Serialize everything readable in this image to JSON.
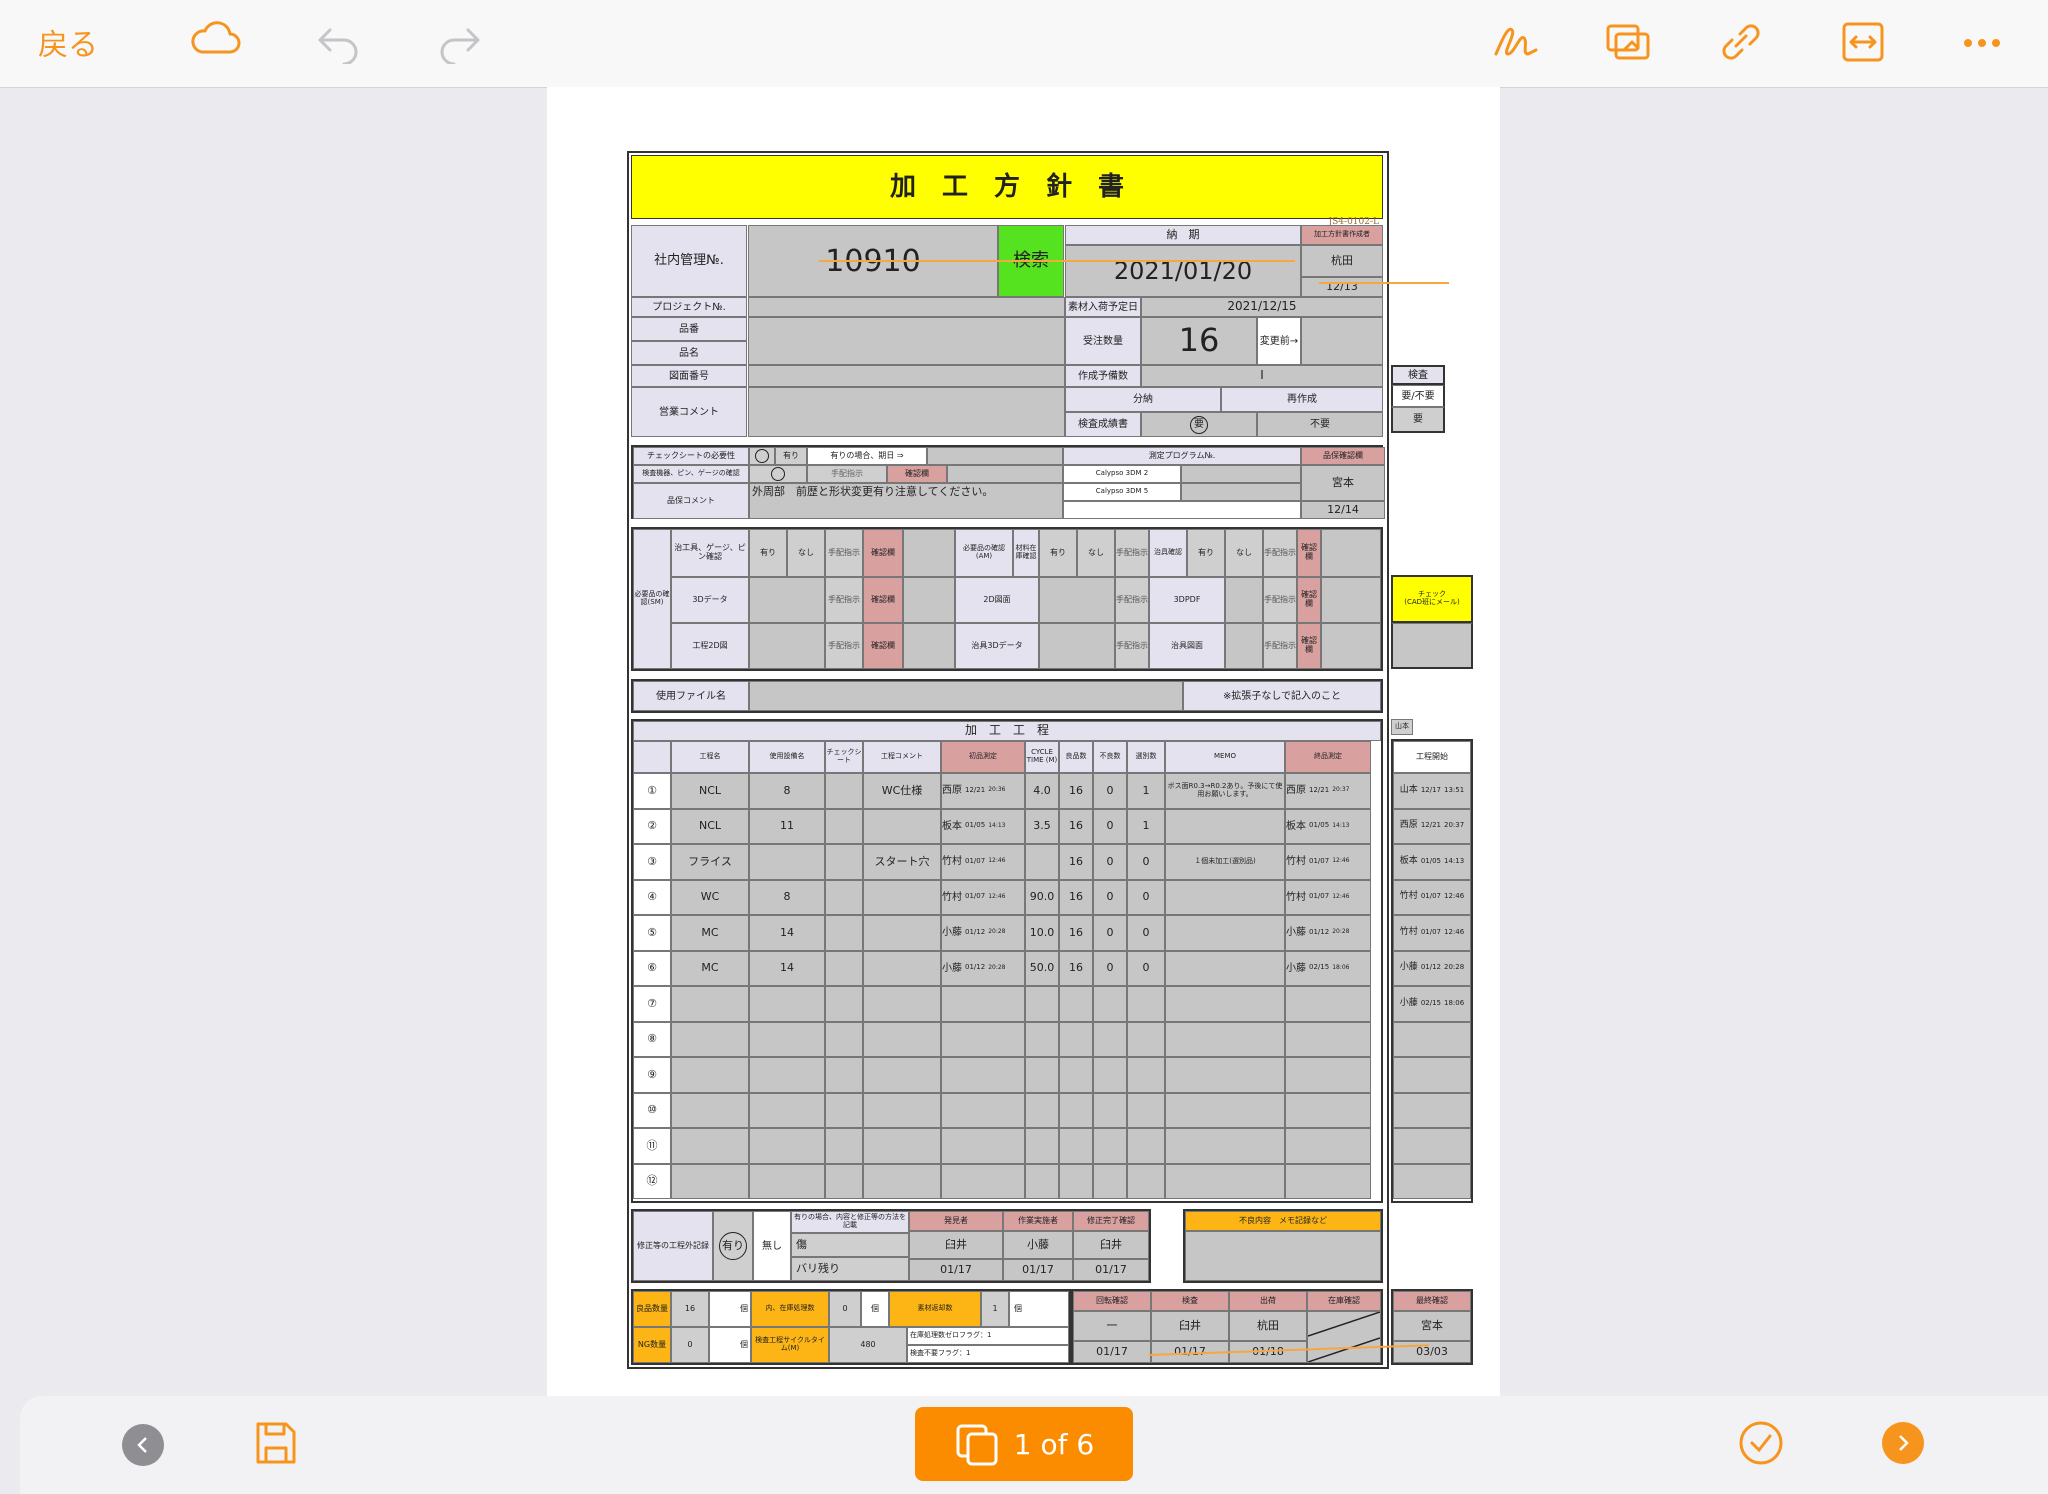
{
  "toolbar": {
    "back_label": "戻る",
    "icons": [
      "cloud-icon",
      "undo-icon",
      "redo-icon",
      "pen-icon",
      "annotate-icon",
      "link-icon",
      "fit-width-icon",
      "more-icon"
    ]
  },
  "doc": {
    "title": "加　工　方　針　書",
    "form_code": "JS4-0102-L",
    "mgmt_label": "社内管理№.",
    "mgmt_no": "10910",
    "search_btn": "検索",
    "nouki_label": "納　期",
    "nouki": "2021/01/20",
    "author_label": "加工方針書作成者",
    "author": "杭田",
    "author_date": "12/13",
    "project_label": "プロジェクト№.",
    "material_label": "素材入荷予定日",
    "material_date": "2021/12/15",
    "hinban_label": "品番",
    "hinmei_label": "品名",
    "zumen_label": "図面番号",
    "order_qty_label": "受注数量",
    "order_qty": "16",
    "change_label": "変更前→",
    "spare_label": "作成予備数",
    "spare_val": "I",
    "sales_label": "営業コメント",
    "bunno": "分納",
    "saisakusei": "再作成",
    "inspect_doc": "検査成績書",
    "yo": "要",
    "fuyo": "不要",
    "kensa": "検査",
    "yofuyo": "要/不要",
    "yo2": "要",
    "check_sheet_label": "チェックシートの必要性",
    "ari": "有り",
    "ari_note": "有りの場合、期日 ⇒",
    "gauge_label": "検査機器、ピン、ゲージの確認",
    "tehai": "手配指示",
    "kakunin": "確認欄",
    "qa_comment_label": "品保コメント",
    "qa_comment": "外周部　前歴と形状変更有り注意してください。",
    "program_label": "測定プログラム№.",
    "program1": "Calypso 3DM 2",
    "program2": "Calypso 3DM 5",
    "qa_check_label": "品保確認欄",
    "qa_name": "宮本",
    "qa_date": "12/14",
    "req_label": "必要品の確認(SM)",
    "jig_label": "治工具、ゲージ、ピン確認",
    "nashi": "なし",
    "data3d": "3Dデータ",
    "drawing2d": "工程2D図",
    "am_label": "必要品の確認(AM)",
    "zaiko": "材料在庫確認",
    "zumen2d": "2D図面",
    "jig3d": "治具3Dデータ",
    "jig_label2": "治具確認",
    "pdf3d": "3DPDF",
    "jig_drawing": "治具図面",
    "check_cad": "チェック\n(CAD班にメール)",
    "file_label": "使用ファイル名",
    "file_note": "※拡張子なしで記入のこと",
    "process_title": "加　工　工　程",
    "yamamoto_tag": "山本",
    "proc_headers": [
      "工程名",
      "使用設備名",
      "チェックシート",
      "工程コメント",
      "初品測定",
      "CYCLE TIME (M)",
      "良品数",
      "不良数",
      "選別数",
      "MEMO",
      "終品測定",
      "工程開始"
    ],
    "rows": [
      {
        "no": "①",
        "name": "NCL",
        "equip": "8",
        "comment": "WC仕様",
        "first": "西原",
        "fd": "12/21",
        "ft": "20:36",
        "cycle": "4.0",
        "good": "16",
        "bad": "0",
        "sel": "1",
        "memo": "ボス面R0.3→R0.2あり。予後にて使用お願いします。",
        "last": "西原",
        "ld": "12/21",
        "lt": "20:37",
        "start": "山本",
        "sd": "12/17",
        "st": "13:51"
      },
      {
        "no": "②",
        "name": "NCL",
        "equip": "11",
        "comment": "",
        "first": "板本",
        "fd": "01/05",
        "ft": "14:13",
        "cycle": "3.5",
        "good": "16",
        "bad": "0",
        "sel": "1",
        "memo": "",
        "last": "板本",
        "ld": "01/05",
        "lt": "14:13",
        "start": "西原",
        "sd": "12/21",
        "st": "20:37"
      },
      {
        "no": "③",
        "name": "フライス",
        "equip": "",
        "comment": "スタート穴",
        "first": "竹村",
        "fd": "01/07",
        "ft": "12:46",
        "cycle": "",
        "good": "16",
        "bad": "0",
        "sel": "0",
        "memo": "１個未加工(選別品)",
        "last": "竹村",
        "ld": "01/07",
        "lt": "12:46",
        "start": "板本",
        "sd": "01/05",
        "st": "14:13"
      },
      {
        "no": "④",
        "name": "WC",
        "equip": "8",
        "comment": "",
        "first": "竹村",
        "fd": "01/07",
        "ft": "12:46",
        "cycle": "90.0",
        "good": "16",
        "bad": "0",
        "sel": "0",
        "memo": "",
        "last": "竹村",
        "ld": "01/07",
        "lt": "12:46",
        "start": "竹村",
        "sd": "01/07",
        "st": "12:46"
      },
      {
        "no": "⑤",
        "name": "MC",
        "equip": "14",
        "comment": "",
        "first": "小藤",
        "fd": "01/12",
        "ft": "20:28",
        "cycle": "10.0",
        "good": "16",
        "bad": "0",
        "sel": "0",
        "memo": "",
        "last": "小藤",
        "ld": "01/12",
        "lt": "20:28",
        "start": "竹村",
        "sd": "01/07",
        "st": "12:46"
      },
      {
        "no": "⑥",
        "name": "MC",
        "equip": "14",
        "comment": "",
        "first": "小藤",
        "fd": "01/12",
        "ft": "20:28",
        "cycle": "50.0",
        "good": "16",
        "bad": "0",
        "sel": "0",
        "memo": "",
        "last": "小藤",
        "ld": "02/15",
        "lt": "18:06",
        "start": "小藤",
        "sd": "01/12",
        "st": "20:28"
      },
      {
        "no": "⑦",
        "name": "",
        "equip": "",
        "comment": "",
        "first": "",
        "fd": "",
        "ft": "",
        "cycle": "",
        "good": "",
        "bad": "",
        "sel": "",
        "memo": "",
        "last": "",
        "ld": "",
        "lt": "",
        "start": "小藤",
        "sd": "02/15",
        "st": "18:06"
      },
      {
        "no": "⑧",
        "name": "",
        "equip": "",
        "comment": "",
        "first": "",
        "fd": "",
        "ft": "",
        "cycle": "",
        "good": "",
        "bad": "",
        "sel": "",
        "memo": "",
        "last": "",
        "ld": "",
        "lt": "",
        "start": "",
        "sd": "",
        "st": ""
      },
      {
        "no": "⑨",
        "name": "",
        "equip": "",
        "comment": "",
        "first": "",
        "fd": "",
        "ft": "",
        "cycle": "",
        "good": "",
        "bad": "",
        "sel": "",
        "memo": "",
        "last": "",
        "ld": "",
        "lt": "",
        "start": "",
        "sd": "",
        "st": ""
      },
      {
        "no": "⑩",
        "name": "",
        "equip": "",
        "comment": "",
        "first": "",
        "fd": "",
        "ft": "",
        "cycle": "",
        "good": "",
        "bad": "",
        "sel": "",
        "memo": "",
        "last": "",
        "ld": "",
        "lt": "",
        "start": "",
        "sd": "",
        "st": ""
      },
      {
        "no": "⑪",
        "name": "",
        "equip": "",
        "comment": "",
        "first": "",
        "fd": "",
        "ft": "",
        "cycle": "",
        "good": "",
        "bad": "",
        "sel": "",
        "memo": "",
        "last": "",
        "ld": "",
        "lt": "",
        "start": "",
        "sd": "",
        "st": ""
      },
      {
        "no": "⑫",
        "name": "",
        "equip": "",
        "comment": "",
        "first": "",
        "fd": "",
        "ft": "",
        "cycle": "",
        "good": "",
        "bad": "",
        "sel": "",
        "memo": "",
        "last": "",
        "ld": "",
        "lt": "",
        "start": "",
        "sd": "",
        "st": ""
      }
    ],
    "fix_label": "修正等の工程外記録",
    "fix_ari": "有り",
    "fix_nashi": "無し",
    "fix_note": "有りの場合、内容と修正等の方法を記載",
    "fix_content1": "傷",
    "fix_content2": "バリ残り",
    "finder_label": "発見者",
    "finder": "臼井",
    "finder_date": "01/17",
    "worker_label": "作業実施者",
    "worker": "小藤",
    "worker_date": "01/17",
    "fixdone_label": "修正完了確認",
    "fixdone": "臼井",
    "fixdone_date": "01/17",
    "defect_label": "不良内容　メモ記録など",
    "good_qty_label": "良品数量",
    "good_qty": "16",
    "unit": "個",
    "stock_label": "内、在庫処理数",
    "stock_qty": "0",
    "return_label": "素材返却数",
    "return_qty": "1",
    "ng_label": "NG数量",
    "ng_qty": "0",
    "cycle_label": "検査工程サイクルタイム(M)",
    "cycle_val": "480",
    "zero_flag": "在庫処理数ゼロフラグ：1",
    "zero_flag_val": "1",
    "noinsp_flag": "検査不要フラグ：1",
    "rot_label": "回転確認",
    "rot_val": "一",
    "rot_date": "01/17",
    "insp_label": "検査",
    "insp_val": "臼井",
    "insp_date": "01/17",
    "ship_label": "出荷",
    "ship_val": "杭田",
    "ship_date": "01/18",
    "stockchk_label": "在庫確認",
    "final_label": "最終確認",
    "final_val": "宮本",
    "final_date": "03/03"
  },
  "bottom": {
    "page_label": "1 of 6",
    "icons": [
      "prev-icon",
      "save-icon",
      "check-icon",
      "next-icon"
    ]
  }
}
